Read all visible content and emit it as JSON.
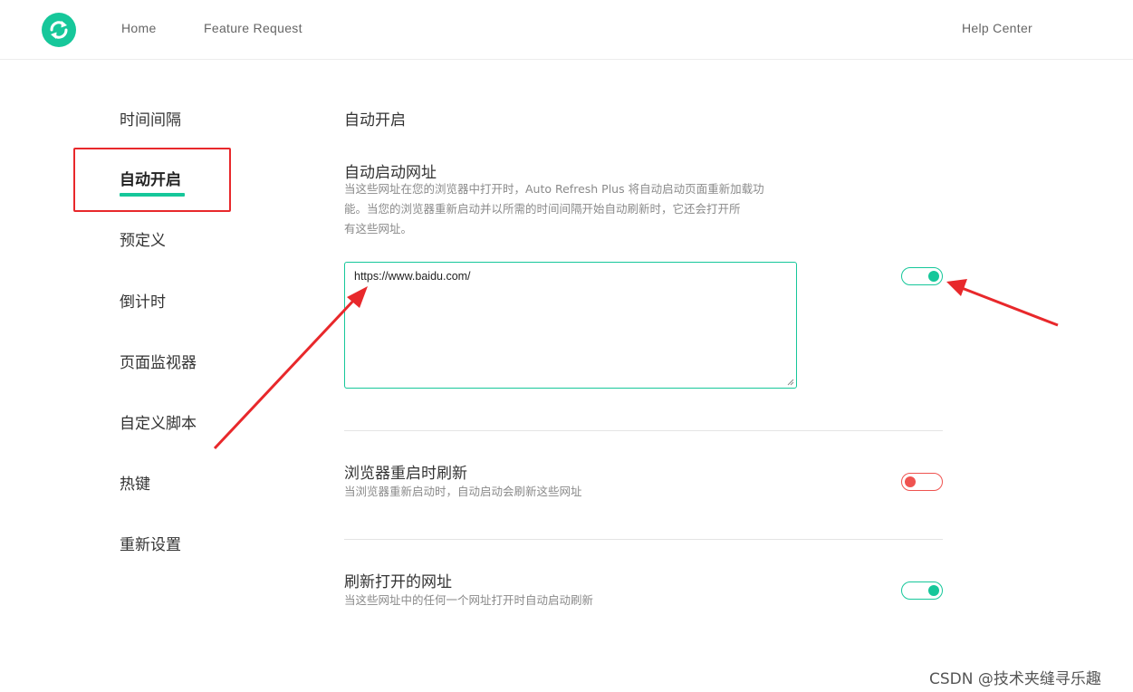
{
  "header": {
    "logo_icon": "refresh-icon",
    "nav": {
      "home": "Home",
      "feature_request": "Feature Request",
      "help_center": "Help Center"
    }
  },
  "sidebar": {
    "items": [
      {
        "label": "时间间隔"
      },
      {
        "label": "自动开启",
        "active": true
      },
      {
        "label": "预定义"
      },
      {
        "label": "倒计时"
      },
      {
        "label": "页面监视器"
      },
      {
        "label": "自定义脚本"
      },
      {
        "label": "热键"
      },
      {
        "label": "重新设置"
      }
    ]
  },
  "main": {
    "section_title": "自动开启",
    "auto_start_urls": {
      "title": "自动启动网址",
      "desc_line1": "当这些网址在您的浏览器中打开时，Auto Refresh Plus 将自动启动页面重新加载功",
      "desc_line2": "能。当您的浏览器重新启动并以所需的时间间隔开始自动刷新时，它还会打开所",
      "desc_line3": "有这些网址。",
      "value": "https://www.baidu.com/",
      "enabled": true
    },
    "refresh_on_restart": {
      "title": "浏览器重启时刷新",
      "desc": "当浏览器重新启动时，自动启动会刷新这些网址",
      "enabled": false
    },
    "refresh_opened": {
      "title": "刷新打开的网址",
      "desc": "当这些网址中的任何一个网址打开时自动启动刷新",
      "enabled": true
    }
  },
  "colors": {
    "accent": "#16c79a",
    "off": "#ef5350",
    "annotation": "#e8282b"
  },
  "watermark": "CSDN @技术夹缝寻乐趣"
}
